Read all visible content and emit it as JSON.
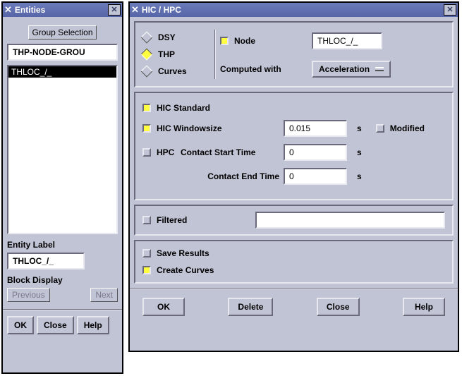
{
  "entities": {
    "title": "Entities",
    "group_selection_button": "Group Selection",
    "group_input_value": "THP-NODE-GROU",
    "list_items": [
      "THLOC_/_"
    ],
    "entity_label_caption": "Entity Label",
    "entity_label_value": "THLOC_/_",
    "block_display_caption": "Block Display",
    "prev_btn": "Previous",
    "next_btn": "Next",
    "ok": "OK",
    "close": "Close",
    "help": "Help"
  },
  "hic": {
    "title": "HIC / HPC",
    "radio": {
      "dsy": "DSY",
      "thp": "THP",
      "curves": "Curves"
    },
    "node_label": "Node",
    "node_value": "THLOC_/_",
    "computed_with_label": "Computed with",
    "computed_with_value": "Acceleration",
    "hic_standard_label": "HIC Standard",
    "hic_windowsize_label": "HIC Windowsize",
    "hic_windowsize_value": "0.015",
    "unit_s": "s",
    "modified_label": "Modified",
    "hpc_label": "HPC",
    "contact_start_label": "Contact Start Time",
    "contact_start_value": "0",
    "contact_end_label": "Contact End Time",
    "contact_end_value": "0",
    "filtered_label": "Filtered",
    "filtered_value": "",
    "save_results_label": "Save Results",
    "create_curves_label": "Create Curves",
    "ok": "OK",
    "delete": "Delete",
    "close": "Close",
    "help": "Help"
  }
}
